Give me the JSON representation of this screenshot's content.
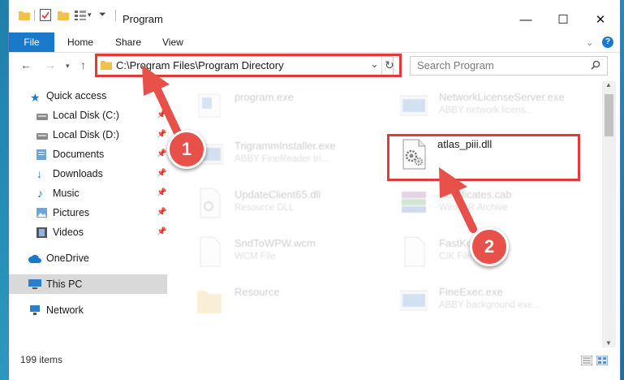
{
  "window": {
    "title": "Program",
    "controls": {
      "minimize": "—",
      "maximize": "☐",
      "close": "✕"
    }
  },
  "ribbon": {
    "tabs": [
      "File",
      "Home",
      "Share",
      "View"
    ],
    "help": "?"
  },
  "address_bar": {
    "path": "C:\\Program Files\\Program Directory",
    "refresh": "↻",
    "dropdown": "⌄"
  },
  "search": {
    "placeholder": "Search Program"
  },
  "nav_pane": {
    "quick_access": "Quick access",
    "items": [
      {
        "label": "Local Disk (C:)",
        "icon": "drive-icon",
        "pinned": true
      },
      {
        "label": "Local Disk (D:)",
        "icon": "drive-icon",
        "pinned": true
      },
      {
        "label": "Documents",
        "icon": "documents-icon",
        "pinned": true
      },
      {
        "label": "Downloads",
        "icon": "download-arrow-icon",
        "pinned": true
      },
      {
        "label": "Music",
        "icon": "music-note-icon",
        "pinned": true
      },
      {
        "label": "Pictures",
        "icon": "pictures-icon",
        "pinned": true
      },
      {
        "label": "Videos",
        "icon": "film-icon",
        "pinned": true
      }
    ],
    "onedrive": "OneDrive",
    "this_pc": "This PC",
    "network": "Network"
  },
  "files": [
    {
      "name": "program.exe",
      "desc": ""
    },
    {
      "name": "NetworkLicenseServer.exe",
      "desc": "ABBY network licens..."
    },
    {
      "name": "TrigrammInstaller.exe",
      "desc": "ABBY FineReader tri..."
    },
    {
      "name": "atlas_piii.dll",
      "desc": ""
    },
    {
      "name": "UpdateClient65.dll",
      "desc": "Resource DLL"
    },
    {
      "name": "Certificates.cab",
      "desc": "WinRAR Archive"
    },
    {
      "name": "SndToWPW.wcm",
      "desc": "WCM File"
    },
    {
      "name": "FastKor",
      "desc": "CIK File"
    },
    {
      "name": "Resource",
      "desc": ""
    },
    {
      "name": "FineExec.exe",
      "desc": "ABBY background exe..."
    }
  ],
  "status": {
    "item_count": "199 items"
  },
  "annotations": {
    "step1": "1",
    "step2": "2"
  },
  "colors": {
    "accent": "#1979ca",
    "annotation_red": "#e03a3a",
    "selected_bg": "#d9d9d9"
  }
}
